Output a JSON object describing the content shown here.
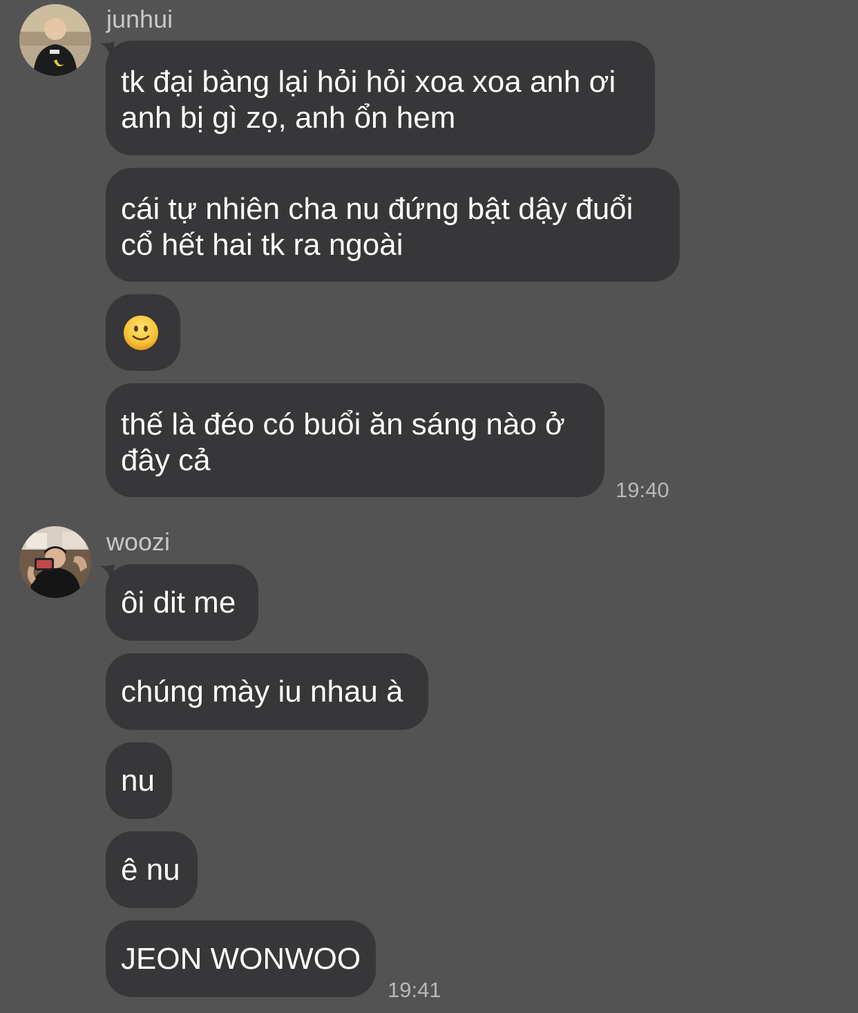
{
  "groups": [
    {
      "sender": "junhui",
      "avatar_icon": "user-avatar-junhui",
      "messages": [
        {
          "lines": [
            "tk đại bàng lại hỏi hỏi xoa xoa anh ơi",
            "anh bị gì zọ, anh ổn hem"
          ]
        },
        {
          "lines": [
            "cái tự nhiên cha nu đứng bật dậy đuổi",
            "cổ hết hai tk ra ngoài"
          ]
        },
        {
          "emoji": "slightly-smiling-face-icon"
        },
        {
          "lines": [
            "thế là đéo có buổi ăn sáng nào ở",
            "đây cả"
          ]
        }
      ],
      "time": "19:40"
    },
    {
      "sender": "woozi",
      "avatar_icon": "user-avatar-woozi",
      "messages": [
        {
          "lines": [
            "ôi dit me"
          ]
        },
        {
          "lines": [
            "chúng mày iu nhau à"
          ]
        },
        {
          "lines": [
            "nu"
          ]
        },
        {
          "lines": [
            "ê nu"
          ]
        },
        {
          "lines": [
            "JEON WONWOO"
          ]
        }
      ],
      "time": "19:41"
    }
  ],
  "colors": {
    "background": "#545354",
    "bubble": "#373638",
    "text": "#ffffff",
    "meta_text": "#b9b8b9"
  }
}
